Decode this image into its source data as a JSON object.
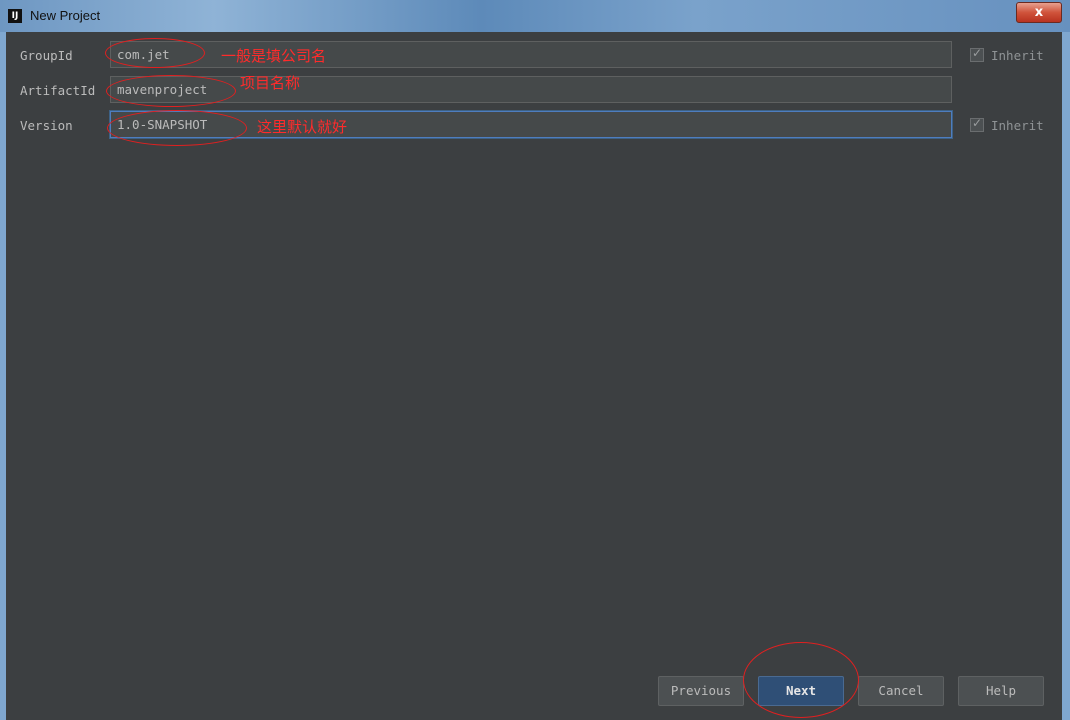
{
  "window": {
    "title": "New Project",
    "app_icon": "IJ",
    "close_glyph": "x"
  },
  "form": {
    "group_id": {
      "label": "GroupId",
      "value": "com.jet",
      "inherit_label": "Inherit"
    },
    "artifact_id": {
      "label": "ArtifactId",
      "value": "mavenproject"
    },
    "version": {
      "label": "Version",
      "value": "1.0-SNAPSHOT",
      "inherit_label": "Inherit"
    }
  },
  "annotations": {
    "group_note": "一般是填公司名",
    "artifact_note": "项目名称",
    "version_note": "这里默认就好"
  },
  "buttons": {
    "previous": "Previous",
    "next": "Next",
    "cancel": "Cancel",
    "help": "Help"
  },
  "colors": {
    "background": "#3c3f41",
    "field": "#45494a",
    "annotation": "#ff2b2b",
    "primary_button": "#2f4f76"
  }
}
